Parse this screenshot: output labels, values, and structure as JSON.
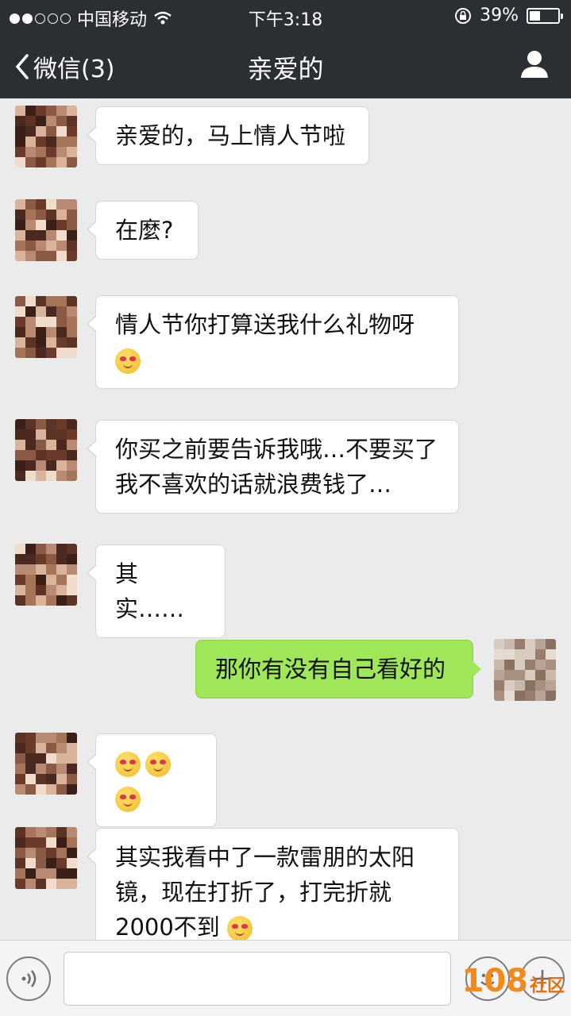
{
  "status_bar": {
    "carrier": "中国移动",
    "time": "下午3:18",
    "battery_percent": "39%",
    "battery_level": 0.39,
    "signal_bars_filled": 2,
    "signal_bars_total": 5
  },
  "nav": {
    "back_label": "微信(3)",
    "title": "亲爱的"
  },
  "messages": [
    {
      "side": "left",
      "text": "亲爱的，马上情人节啦",
      "emoji_count": 0
    },
    {
      "side": "left",
      "text": "在麼?",
      "emoji_count": 0
    },
    {
      "side": "left",
      "text": "情人节你打算送我什么礼物呀",
      "emoji_count": 1
    },
    {
      "side": "left",
      "text": "你买之前要告诉我哦…不要买了我不喜欢的话就浪费钱了…",
      "emoji_count": 0
    },
    {
      "side": "left",
      "text": "其实……",
      "emoji_count": 0
    },
    {
      "side": "right",
      "text": "那你有没有自己看好的",
      "emoji_count": 0
    },
    {
      "side": "left",
      "text": "",
      "emoji_count": 3
    },
    {
      "side": "left",
      "text": "其实我看中了一款雷朋的太阳镜，现在打折了，打完折就2000不到",
      "emoji_count": 1
    }
  ],
  "input_bar": {
    "value": "",
    "placeholder": ""
  },
  "watermark": {
    "number": "108",
    "label": "社区"
  },
  "icons": {
    "back": "chevron-left-icon",
    "profile": "person-icon",
    "voice": "voice-icon",
    "emoji": "emoji-icon",
    "more": "plus-icon"
  },
  "colors": {
    "header_bg": "#2b2e33",
    "chat_bg": "#ebebeb",
    "self_bubble": "#9fe658",
    "other_bubble": "#ffffff"
  }
}
